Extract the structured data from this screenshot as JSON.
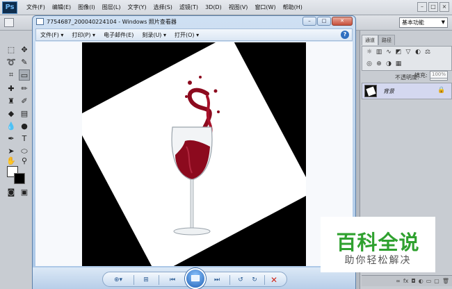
{
  "photoshop": {
    "logo": "Ps",
    "menu": [
      "文件(F)",
      "编辑(E)",
      "图像(I)",
      "图层(L)",
      "文字(Y)",
      "选择(S)",
      "滤镜(T)",
      "3D(D)",
      "视图(V)",
      "窗口(W)",
      "帮助(H)"
    ],
    "window_controls": [
      "–",
      "□",
      "×"
    ],
    "workspace": "基本功能",
    "panel_tabs": [
      "通道",
      "路径"
    ],
    "layers": {
      "opacity_label": "不透明度:",
      "opacity_value": "100%",
      "fill_label": "填充:",
      "fill_value": "100%",
      "layer_name": "背景",
      "lock_icon": "lock-icon"
    }
  },
  "viewer": {
    "title": "7754687_200040224104 - Windows 照片查看器",
    "menu": [
      "文件(F) ▾",
      "打印(P) ▾",
      "电子邮件(E)",
      "刻录(U) ▾",
      "打开(O) ▾"
    ],
    "help": "?",
    "title_controls": [
      "–",
      "□",
      "✕"
    ],
    "photo": {
      "background": "#000000",
      "card": "#ffffff",
      "wine_color": "#8c0a1e"
    },
    "controls": {
      "icons": [
        "zoom-icon",
        "actual-size-icon",
        "previous-icon",
        "slideshow-icon",
        "next-icon",
        "rotate-ccw-icon",
        "rotate-cw-icon",
        "delete-icon"
      ]
    }
  },
  "watermark": {
    "title": "百科全说",
    "subtitle": "助你轻松解决",
    "color": "#2fa12f"
  }
}
